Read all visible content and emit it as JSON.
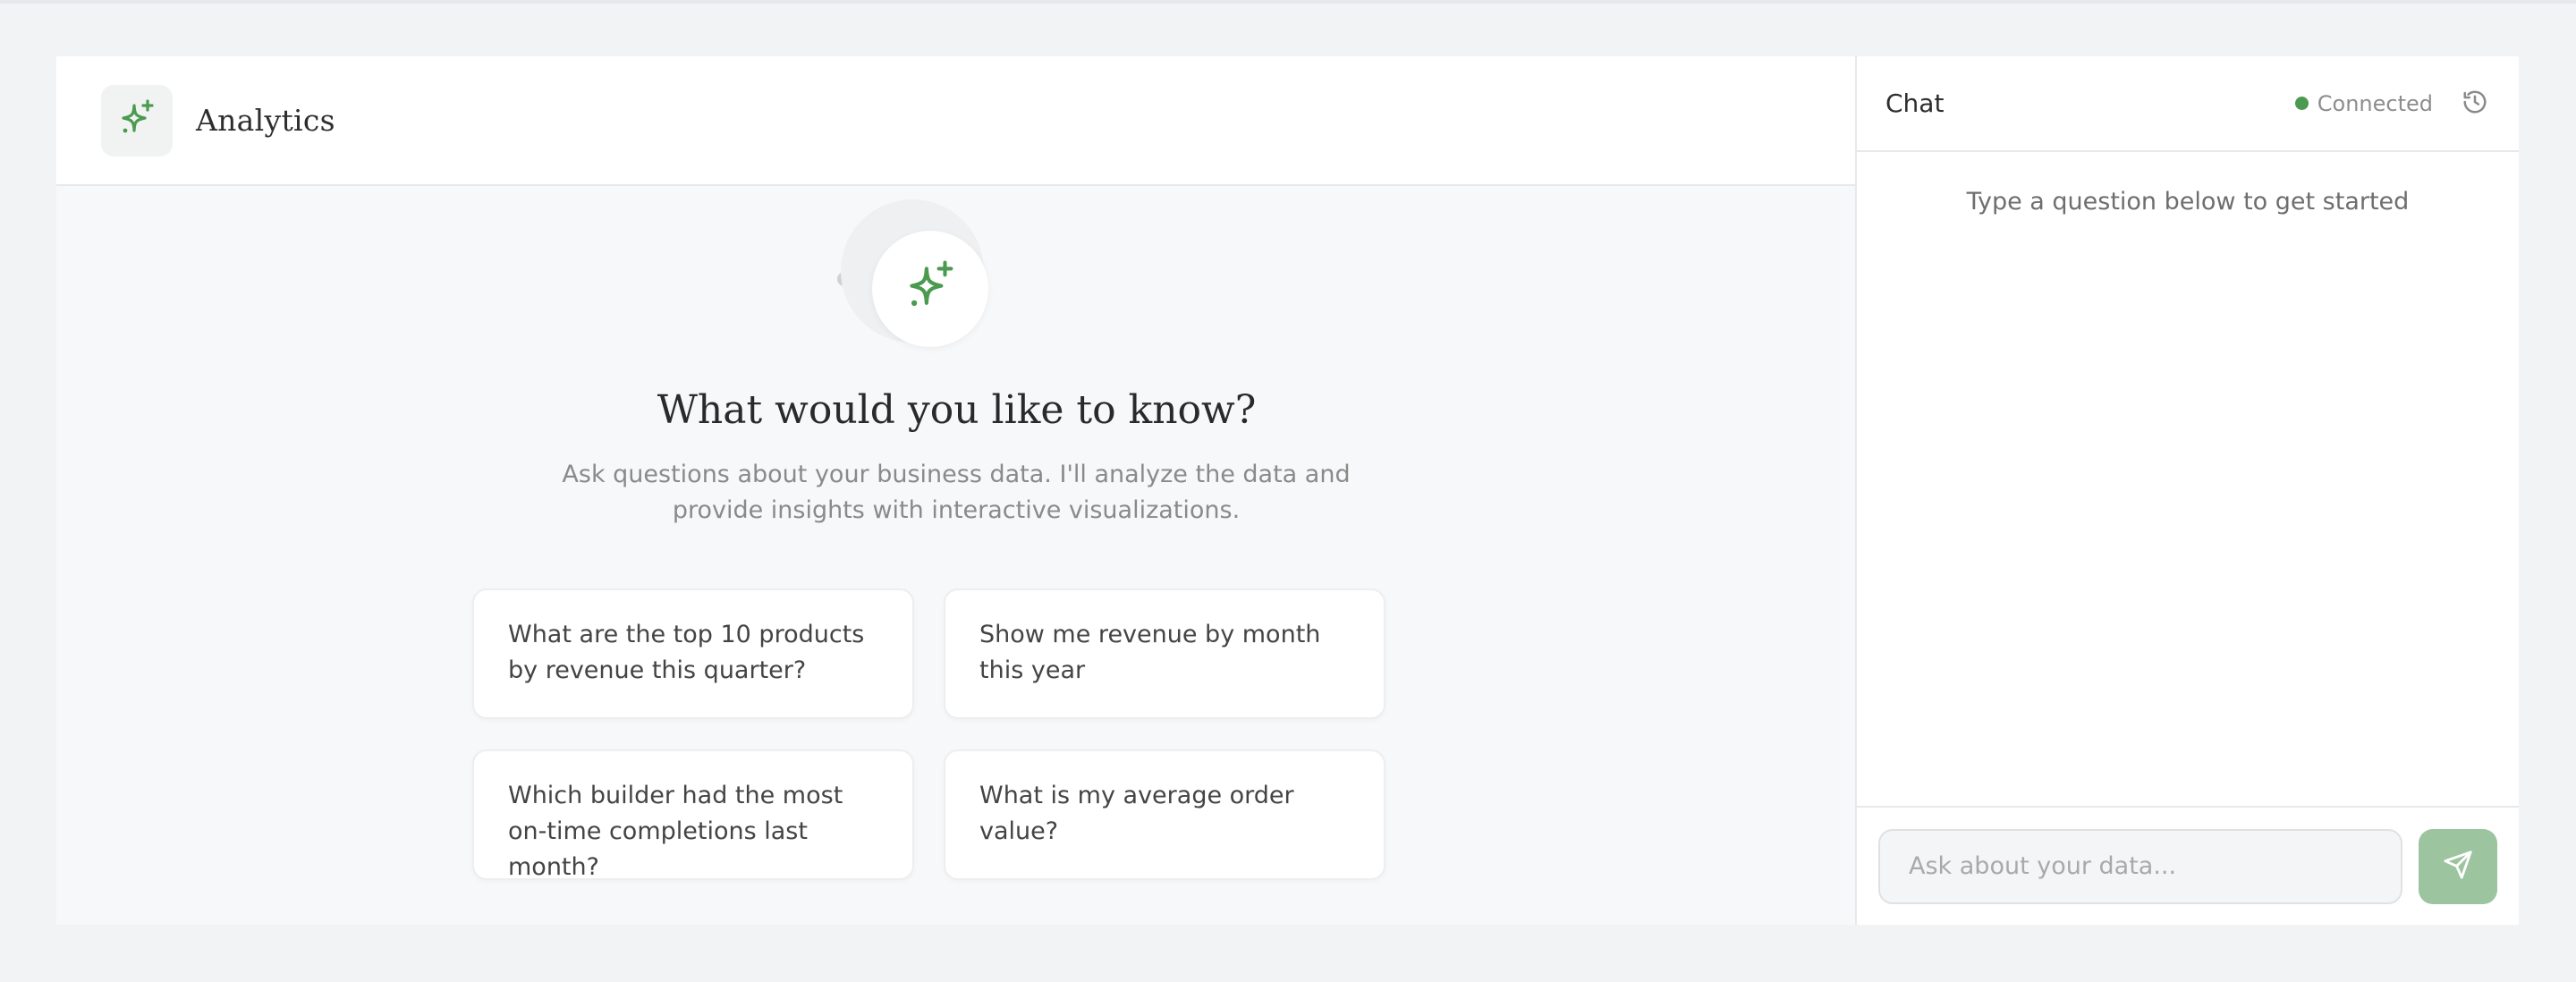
{
  "app": {
    "title": "Analytics"
  },
  "hero": {
    "title": "What would you like to know?",
    "subtitle": "Ask questions about your business data. I'll analyze the data and provide insights with interactive visualizations."
  },
  "suggestions": [
    "What are the top 10 products by revenue this quarter?",
    "Show me revenue by month this year",
    "Which builder had the most on-time completions last month?",
    "What is my average order value?"
  ],
  "chat": {
    "title": "Chat",
    "status": "Connected",
    "empty_hint": "Type a question below to get started",
    "input_placeholder": "Ask about your data..."
  },
  "icons": {
    "logo": "sparkles-icon",
    "hero": "sparkles-icon",
    "history": "history-icon",
    "send": "send-icon"
  },
  "colors": {
    "accent": "#4a9a4f",
    "send_button": "#9cc49e",
    "status_connected": "#4a9a4f"
  }
}
